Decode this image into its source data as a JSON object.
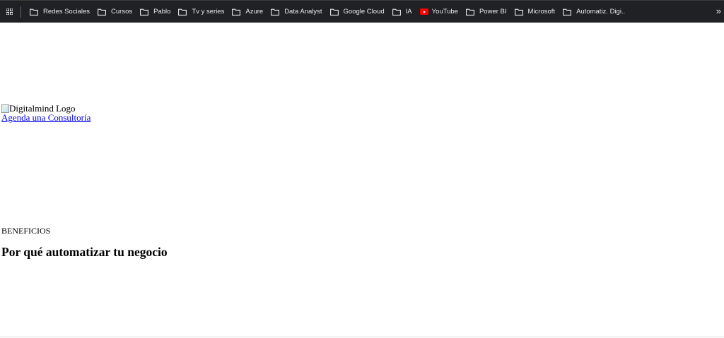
{
  "bookmarks_bar": {
    "apps_icon": "apps-grid-icon",
    "items": [
      {
        "label": "Redes Sociales",
        "icon": "folder-icon"
      },
      {
        "label": "Cursos",
        "icon": "folder-icon"
      },
      {
        "label": "Pablo",
        "icon": "folder-icon"
      },
      {
        "label": "Tv y series",
        "icon": "folder-icon"
      },
      {
        "label": "Azure",
        "icon": "folder-icon"
      },
      {
        "label": "Data Analyst",
        "icon": "folder-icon"
      },
      {
        "label": "Google Cloud",
        "icon": "folder-icon"
      },
      {
        "label": "IA",
        "icon": "folder-icon"
      },
      {
        "label": "YouTube",
        "icon": "youtube-icon"
      },
      {
        "label": "Power BI",
        "icon": "folder-icon"
      },
      {
        "label": "Microsoft",
        "icon": "folder-icon"
      },
      {
        "label": "Automatiz. Digi..",
        "icon": "folder-icon"
      }
    ],
    "overflow_label": "»",
    "colors": {
      "background": "#202124",
      "text": "#e8eaed"
    }
  },
  "page": {
    "logo_alt": "Digitalmind Logo",
    "cta_link": "Agenda una Consultoría",
    "eyebrow": "BENEFICIOS",
    "section_title": "Por qué automatizar tu negocio"
  }
}
